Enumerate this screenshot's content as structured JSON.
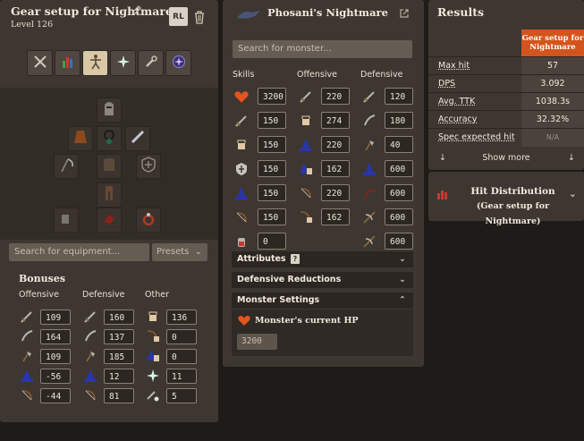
{
  "loadout": {
    "title": "Gear setup for Nightmare",
    "level": "Level 126",
    "rl_badge": "RL",
    "equipment_search_placeholder": "Search for equipment...",
    "presets_label": "Presets",
    "bonuses_title": "Bonuses",
    "bonus_headers": {
      "offensive": "Offensive",
      "defensive": "Defensive",
      "other": "Other"
    },
    "offensive": [
      "109",
      "164",
      "109",
      "-56",
      "-44"
    ],
    "defensive": [
      "160",
      "137",
      "185",
      "12",
      "81"
    ],
    "other": [
      "136",
      "0",
      "0",
      "11",
      "5"
    ]
  },
  "monster": {
    "name": "Phosani's Nightmare",
    "search_placeholder": "Search for monster...",
    "headers": {
      "skills": "Skills",
      "offensive": "Offensive",
      "defensive": "Defensive"
    },
    "skills": [
      "3200",
      "150",
      "150",
      "150",
      "150",
      "150",
      "0"
    ],
    "offensive": [
      "220",
      "274",
      "220",
      "162",
      "220",
      "162"
    ],
    "defensive": [
      "120",
      "180",
      "40",
      "600",
      "600",
      "600",
      "600"
    ],
    "sections": {
      "attributes": "Attributes",
      "attributes_help": "?",
      "defensive_reductions": "Defensive Reductions",
      "monster_settings": "Monster Settings"
    },
    "current_hp_label": "Monster's current HP",
    "current_hp": "3200"
  },
  "results": {
    "title": "Results",
    "column_header": "Gear setup for Nightmare",
    "rows": [
      {
        "label": "Max hit",
        "value": "57"
      },
      {
        "label": "DPS",
        "value": "3.092"
      },
      {
        "label": "Avg. TTK",
        "value": "1038.3s"
      },
      {
        "label": "Accuracy",
        "value": "32.32%"
      },
      {
        "label": "Spec expected hit",
        "value": "N/A"
      }
    ],
    "show_more": "Show more"
  },
  "hit_distribution": {
    "title": "Hit Distribution",
    "subtitle": "(Gear setup for Nightmare)"
  },
  "colors": {
    "accent": "#d3541c",
    "panel": "#3e3731",
    "background": "#1e1b18"
  }
}
